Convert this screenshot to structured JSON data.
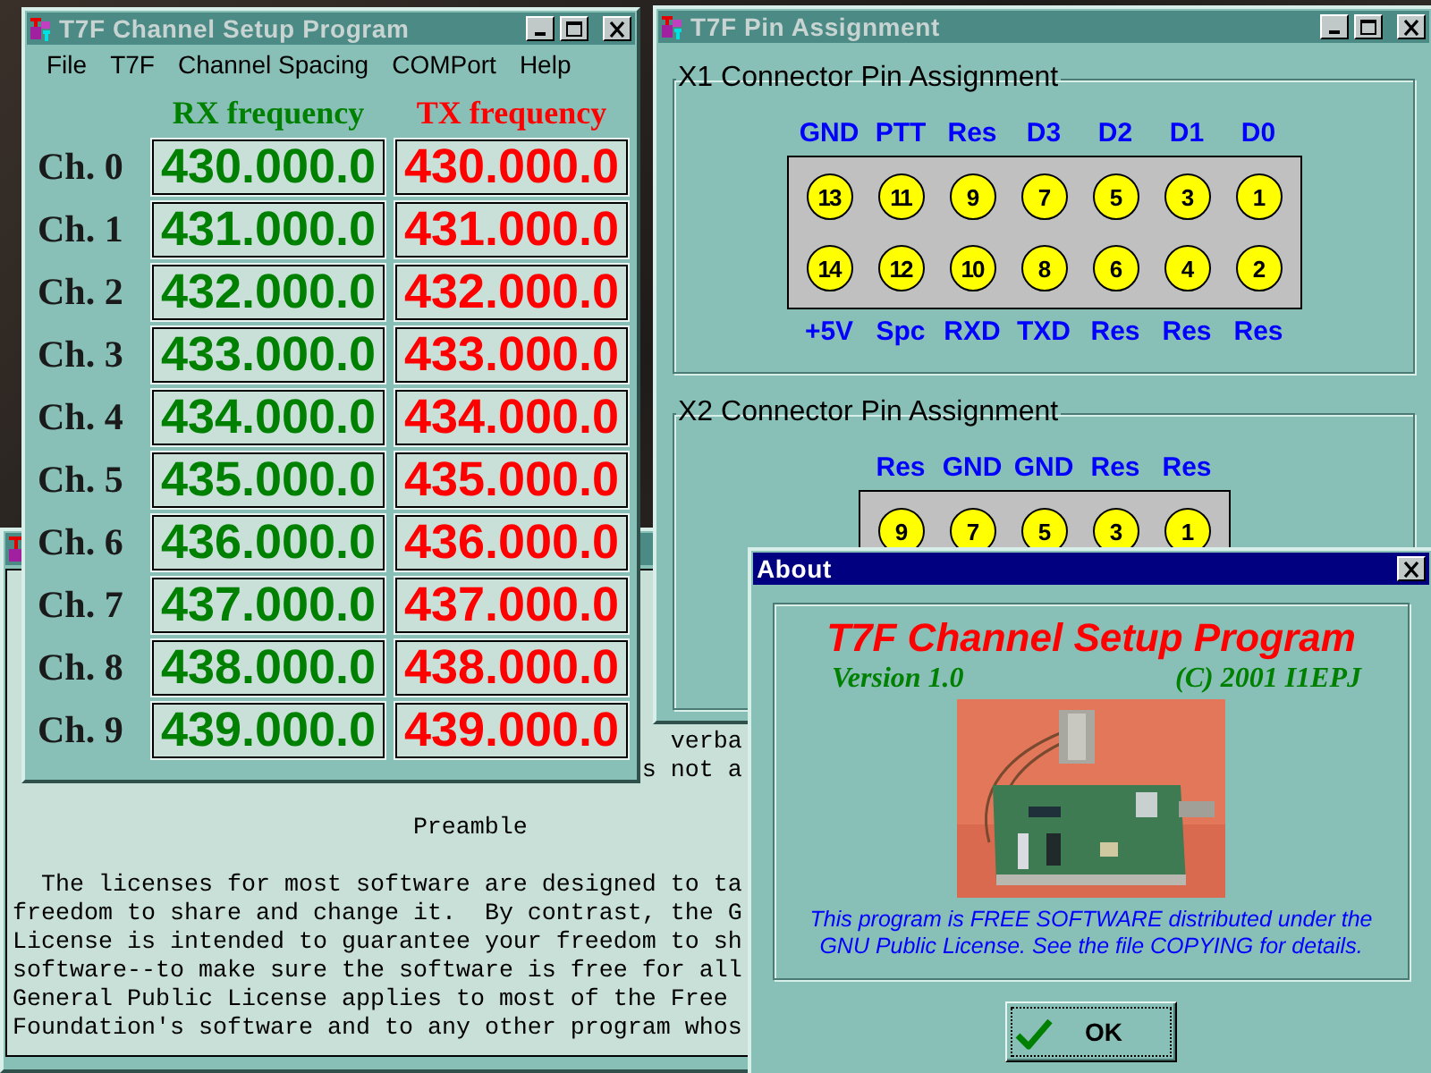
{
  "text_window": {
    "lines": [
      {
        "kind": "fragment2",
        "text": "verba"
      },
      {
        "kind": "fragment",
        "text": "s not a"
      },
      {
        "kind": "heading",
        "text": "Preamble"
      },
      {
        "kind": "indent",
        "text": "The licenses for most software are designed to ta"
      },
      {
        "kind": "plain",
        "text": "freedom to share and change it.  By contrast, the G"
      },
      {
        "kind": "plain",
        "text": "License is intended to guarantee your freedom to sh"
      },
      {
        "kind": "plain",
        "text": "software--to make sure the software is free for all"
      },
      {
        "kind": "plain",
        "text": "General Public License applies to most of the Free"
      },
      {
        "kind": "plain",
        "text": "Foundation's software and to any other program whos"
      }
    ]
  },
  "channel_window": {
    "title": "T7F Channel Setup Program",
    "menu": [
      "File",
      "T7F",
      "Channel Spacing",
      "COMPort",
      "Help"
    ],
    "columns": [
      "RX frequency",
      "TX frequency"
    ],
    "channels": [
      {
        "label": "Ch. 0",
        "rx": "430.000.0",
        "tx": "430.000.0"
      },
      {
        "label": "Ch. 1",
        "rx": "431.000.0",
        "tx": "431.000.0"
      },
      {
        "label": "Ch. 2",
        "rx": "432.000.0",
        "tx": "432.000.0"
      },
      {
        "label": "Ch. 3",
        "rx": "433.000.0",
        "tx": "433.000.0"
      },
      {
        "label": "Ch. 4",
        "rx": "434.000.0",
        "tx": "434.000.0"
      },
      {
        "label": "Ch. 5",
        "rx": "435.000.0",
        "tx": "435.000.0"
      },
      {
        "label": "Ch. 6",
        "rx": "436.000.0",
        "tx": "436.000.0"
      },
      {
        "label": "Ch. 7",
        "rx": "437.000.0",
        "tx": "437.000.0"
      },
      {
        "label": "Ch. 8",
        "rx": "438.000.0",
        "tx": "438.000.0"
      },
      {
        "label": "Ch. 9",
        "rx": "439.000.0",
        "tx": "439.000.0"
      }
    ]
  },
  "pin_window": {
    "title": "T7F Pin Assignment",
    "connectors": [
      {
        "title": "X1 Connector Pin Assignment",
        "top_labels": [
          "GND",
          "PTT",
          "Res",
          "D3",
          "D2",
          "D1",
          "D0"
        ],
        "pin_rows": [
          [
            "13",
            "11",
            "9",
            "7",
            "5",
            "3",
            "1"
          ],
          [
            "14",
            "12",
            "10",
            "8",
            "6",
            "4",
            "2"
          ]
        ],
        "bottom_labels": [
          "+5V",
          "Spc",
          "RXD",
          "TXD",
          "Res",
          "Res",
          "Res"
        ]
      },
      {
        "title": "X2 Connector Pin Assignment",
        "top_labels": [
          "Res",
          "GND",
          "GND",
          "Res",
          "Res"
        ],
        "pin_rows": [
          [
            "9",
            "7",
            "5",
            "3",
            "1"
          ]
        ]
      }
    ]
  },
  "about_dialog": {
    "title": "About",
    "heading": "T7F Channel Setup Program",
    "version": "Version 1.0",
    "copyright": "(C) 2001 I1EPJ",
    "notice": [
      "This program is FREE SOFTWARE distributed under the",
      "GNU Public License. See the file COPYING for details."
    ],
    "button": "OK"
  }
}
